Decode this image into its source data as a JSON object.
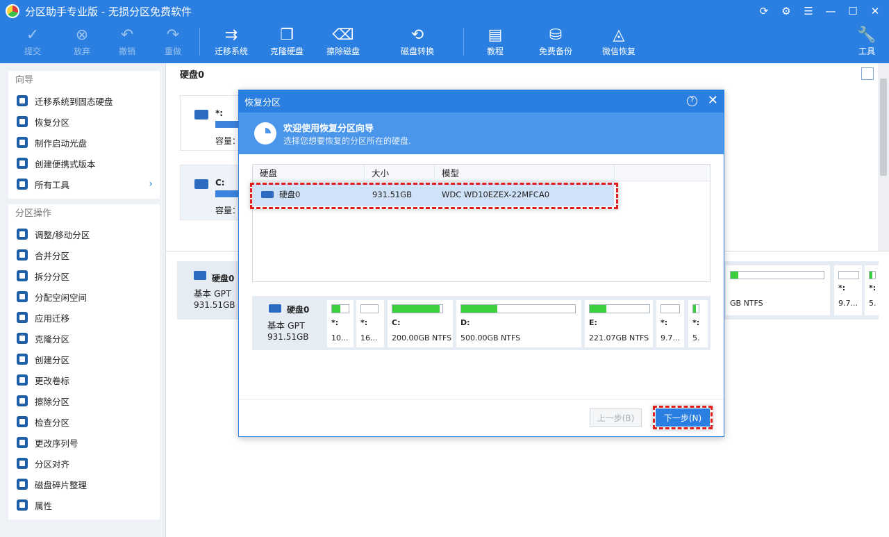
{
  "window": {
    "title": "分区助手专业版 - 无损分区免费软件"
  },
  "toolbar": {
    "commit": "提交",
    "discard": "放弃",
    "undo": "撤销",
    "redo": "重做",
    "migrate_os": "迁移系统",
    "clone_disk": "克隆硬盘",
    "wipe_disk": "擦除磁盘",
    "disk_convert": "磁盘转换",
    "tutorial": "教程",
    "free_backup": "免费备份",
    "wechat_recovery": "微信恢复",
    "tools": "工具"
  },
  "sidebar": {
    "wizard_title": "向导",
    "wizard_items": [
      "迁移系统到固态硬盘",
      "恢复分区",
      "制作启动光盘",
      "创建便携式版本",
      "所有工具"
    ],
    "ops_title": "分区操作",
    "ops_items": [
      "调整/移动分区",
      "合并分区",
      "拆分分区",
      "分配空闲空间",
      "应用迁移",
      "克隆分区",
      "创建分区",
      "更改卷标",
      "擦除分区",
      "检查分区",
      "更改序列号",
      "分区对齐",
      "磁盘碎片整理",
      "属性"
    ]
  },
  "main": {
    "disk_title": "硬盘0",
    "cards": [
      {
        "name": "*:",
        "cap": "容量："
      },
      {
        "name": "C:",
        "cap": "容量："
      }
    ],
    "lower_disk": {
      "name": "硬盘0",
      "type": "基本 GPT",
      "size": "931.51GB"
    },
    "bg_parts": [
      {
        "info": "GB NTFS"
      },
      {
        "name": "*:",
        "info": "9.7..."
      },
      {
        "name": "*:",
        "info": "5."
      }
    ]
  },
  "dialog": {
    "title": "恢复分区",
    "help": "?",
    "header_title": "欢迎使用恢复分区向导",
    "header_sub": "选择您想要恢复的分区所在的硬盘.",
    "columns": [
      "硬盘",
      "大小",
      "模型"
    ],
    "row": {
      "disk": "硬盘0",
      "size": "931.51GB",
      "model": "WDC WD10EZEX-22MFCA0"
    },
    "map": {
      "name": "硬盘0",
      "type": "基本 GPT",
      "size": "931.51GB",
      "partitions": [
        {
          "name": "*:",
          "info": "10...",
          "fill": 0.5
        },
        {
          "name": "*:",
          "info": "16...",
          "fill": 0.0
        },
        {
          "name": "C:",
          "info": "200.00GB NTFS",
          "fill": 0.95
        },
        {
          "name": "D:",
          "info": "500.00GB NTFS",
          "fill": 0.32
        },
        {
          "name": "E:",
          "info": "221.07GB NTFS",
          "fill": 0.28
        },
        {
          "name": "*:",
          "info": "9.7...",
          "fill": 0.0
        },
        {
          "name": "*:",
          "info": "5.",
          "fill": 0.5
        }
      ]
    },
    "btn_prev": "上一步(B)",
    "btn_next": "下一步(N)"
  },
  "colors": {
    "accent": "#2a7fe0",
    "highlight": "#e01e1e",
    "used": "#3dcf3d"
  }
}
